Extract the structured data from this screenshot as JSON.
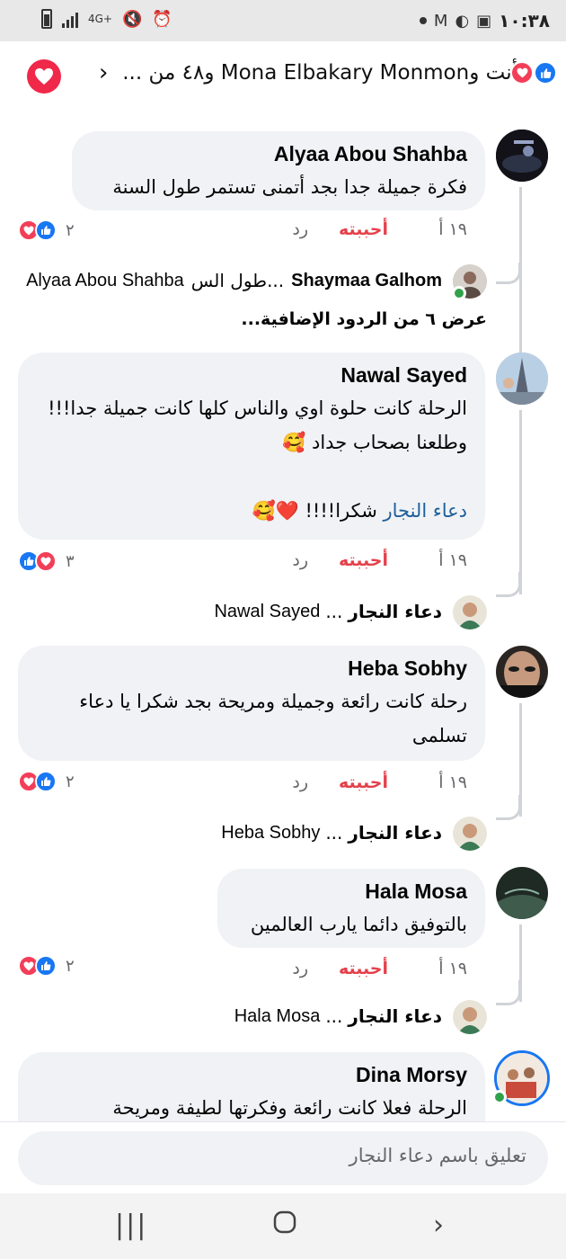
{
  "status": {
    "time": "١٠:٣٨",
    "network": "4G+"
  },
  "header": {
    "title": "أنت وMona Elbakary Monmon و٤٨ من ..."
  },
  "comments": [
    {
      "author": "Alyaa Abou Shahba",
      "text": "فكرة جميلة جدا بجد أتمنى تستمر طول السنة",
      "time": "١٩ أ",
      "like": "أحببته",
      "reply": "رد",
      "react_count": "٢",
      "reply_preview": {
        "author": "Shaymaa Galhom",
        "snippet": "طول الس...",
        "mention": "Alyaa Abou Shahba"
      },
      "more_replies": "عرض ٦ من الردود الإضافية..."
    },
    {
      "author": "Nawal Sayed",
      "text": "الرحلة كانت حلوة اوي والناس كلها كانت جميلة جدا!!! وطلعنا بصحاب جداد 🥰",
      "mention": "دعاء النجار",
      "text2": "شكرا!!!! ❤️🥰",
      "time": "١٩ أ",
      "like": "أحببته",
      "reply": "رد",
      "react_count": "٣",
      "reply_preview": {
        "author": "دعاء النجار",
        "snippet": "...",
        "mention": "Nawal Sayed"
      }
    },
    {
      "author": "Heba Sobhy",
      "text": "رحلة كانت رائعة وجميلة ومريحة بجد شكرا يا دعاء تسلمى",
      "time": "١٩ أ",
      "like": "أحببته",
      "reply": "رد",
      "react_count": "٢",
      "reply_preview": {
        "author": "دعاء النجار",
        "snippet": "...",
        "mention": "Heba Sobhy"
      }
    },
    {
      "author": "Hala Mosa",
      "text": "بالتوفيق دائما يارب العالمين",
      "time": "١٩ أ",
      "like": "أحببته",
      "reply": "رد",
      "react_count": "٢",
      "reply_preview": {
        "author": "دعاء النجار",
        "snippet": "...",
        "mention": "Hala Mosa"
      }
    },
    {
      "author": "Dina Morsy",
      "text": "الرحلة فعلا كانت رائعة وفكرتها لطيفة ومريحة"
    }
  ],
  "composer": {
    "placeholder": "تعليق باسم دعاء النجار"
  },
  "colors": {
    "like_blue": "#1877f2",
    "love_red": "#f33e58",
    "liked_text": "#e4414b",
    "bubble_bg": "#f0f2f5"
  },
  "icons": [
    "heart-icon",
    "like-icon",
    "chevron-right-icon",
    "recent-apps-icon",
    "home-icon",
    "back-icon"
  ]
}
